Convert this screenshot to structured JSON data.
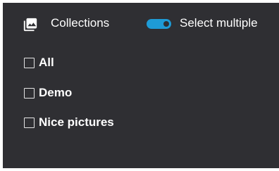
{
  "header": {
    "title": "Collections",
    "icon": "collections-icon",
    "select_multiple_label": "Select multiple",
    "select_multiple_on": true
  },
  "collections": [
    {
      "label": "All",
      "checked": false
    },
    {
      "label": "Demo",
      "checked": false
    },
    {
      "label": "Nice pictures",
      "checked": false
    }
  ],
  "colors": {
    "panel_background": "#2f2f33",
    "toggle_accent": "#1e9bd6",
    "text": "#ffffff"
  }
}
